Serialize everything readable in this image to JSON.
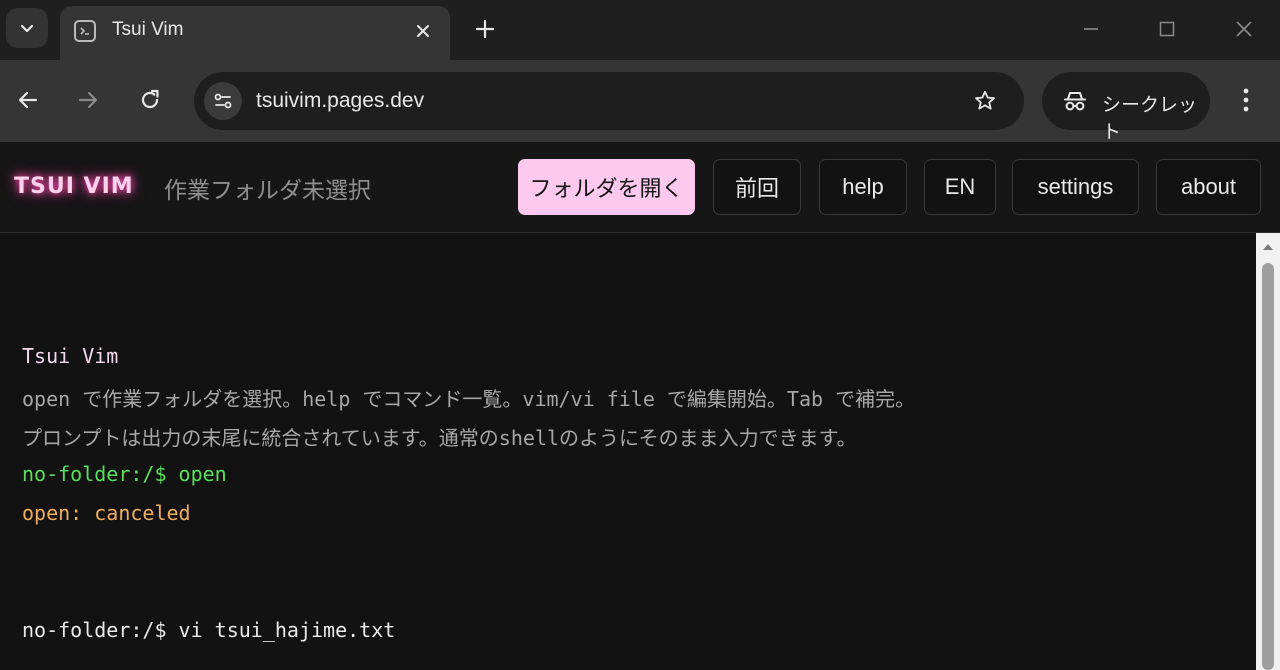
{
  "browser": {
    "tab_title": "Tsui Vim",
    "url": "tsuivim.pages.dev",
    "incognito_label": "シークレット"
  },
  "header": {
    "brand": "TSUI VIM",
    "folder_status": "作業フォルダ未選択",
    "buttons": {
      "open_folder": "フォルダを開く",
      "previous": "前回",
      "help": "help",
      "lang": "EN",
      "settings": "settings",
      "about": "about"
    }
  },
  "terminal": {
    "lines": [
      "Tsui Vim",
      "open で作業フォルダを選択。help でコマンド一覧。vim/vi file で編集開始。Tab で補完。",
      "プロンプトは出力の末尾に統合されています。通常のshellのようにそのまま入力できます。",
      "no-folder:/$ open",
      "open: canceled",
      "no-folder:/$ vi tsui_hajime.txt"
    ]
  },
  "colors": {
    "brand": "#ffd1ec",
    "primary_button": "#ffc8ee",
    "prompt_green": "#57e05b",
    "warning_orange": "#f0ad5f"
  }
}
